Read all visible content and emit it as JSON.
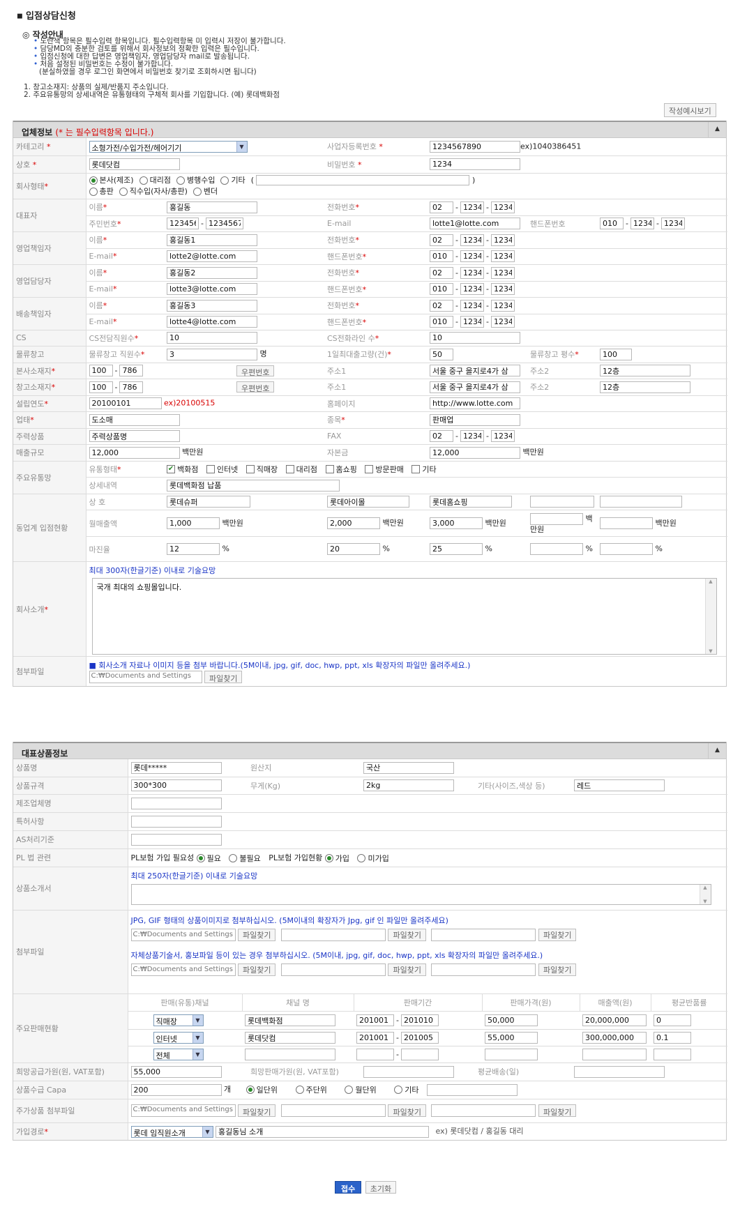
{
  "page_title": "입점상담신청",
  "guide": {
    "title": "작성안내",
    "bullets": [
      "노란색 항목은 필수입력 항목입니다. 필수입력항목 미 입력시 저장이 불가합니다.",
      "담당MD의 충분한 검토를 위해서 회사정보의 정확한 입력은 필수입니다.",
      "입점신청에 대한 답변은 영업책임자, 영업담당자 mail로 발송됩니다.",
      "처음 설정된 비밀번호는 수정이 불가합니다.",
      "(분실하였을 경우 로그인 화면에서 비밀번호 찾기로 조회하시면 됩니다)"
    ],
    "notes": [
      "1.  창고소재지: 상품의 실제/반품지 주소입니다.",
      "2.  주요유통망의 상세내역은 유통형태의 구체적 회사를 기입합니다. (예) 롯데백화점"
    ],
    "example_button": "작성예시보기"
  },
  "common": {
    "star": "*",
    "dash": "-",
    "percent": "%",
    "unit_mil": "백만원",
    "unit_people": "명",
    "unit_ea": "개",
    "zip_button": "우편번호",
    "find_button": "파일찾기",
    "file_path": "C:₩Documents and Settings",
    "paren_open": "(",
    "paren_close": ")"
  },
  "company": {
    "header": "업체정보",
    "header_note": "(* 는 필수입력항목 입니다.)",
    "category_label": "카테고리",
    "category_value": "소형가전/수입가전/헤어기기",
    "bizno_label": "사업자등록번호",
    "bizno_value": "1234567890",
    "bizno_ex": "ex)1040386451",
    "name_label": "상호",
    "name_value": "롯데닷컴",
    "pw_label": "비밀번호",
    "pw_value": "1234",
    "type_label": "회사형태",
    "types": [
      "본사(제조)",
      "대리점",
      "병행수입",
      "기타",
      "총판",
      "직수입(자사/총판)",
      "벤더"
    ],
    "ceo_label": "대표자",
    "role_labels": {
      "name": "이름",
      "jumin": "주민번호",
      "phone": "전화번호",
      "email": "E-mail",
      "mobile": "핸드폰번호"
    },
    "ceo": {
      "name": "홍길동",
      "jumin1": "123456",
      "jumin2": "1234567",
      "phone": [
        "02",
        "1234",
        "1234"
      ],
      "email": "lotte1@lotte.com",
      "mobile": [
        "010",
        "1234",
        "1234"
      ]
    },
    "sales_mgr_label": "영업책임자",
    "sales_mgr": {
      "name": "홍길동1",
      "email": "lotte2@lotte.com",
      "phone": [
        "02",
        "1234",
        "1234"
      ],
      "mobile": [
        "010",
        "1234",
        "1234"
      ]
    },
    "sales_staff_label": "영업담당자",
    "sales_staff": {
      "name": "홍길동2",
      "email": "lotte3@lotte.com",
      "phone": [
        "02",
        "1234",
        "1234"
      ],
      "mobile": [
        "010",
        "1234",
        "1234"
      ]
    },
    "ship_mgr_label": "배송책임자",
    "ship_mgr": {
      "name": "홍길동3",
      "email": "lotte4@lotte.com",
      "phone": [
        "02",
        "1234",
        "1234"
      ],
      "mobile": [
        "010",
        "1234",
        "1234"
      ]
    },
    "cs_label": "CS",
    "cs_staff_label": "CS전담직원수",
    "cs_staff": "10",
    "cs_line_label": "CS전화라인 수",
    "cs_line": "10",
    "wh_label": "물류창고",
    "wh_staff_label": "물류창고 직원수",
    "wh_staff": "3",
    "daily_label": "1일최대출고량(건)",
    "daily": "50",
    "area_label": "물류창고 평수",
    "area": "100",
    "hq_label": "본사소재지",
    "hq_zip": [
      "100",
      "786"
    ],
    "addr1_label": "주소1",
    "hq_addr1": "서울 중구 을지로4가 삼",
    "addr2_label": "주소2",
    "hq_addr2": "12층",
    "store_label": "창고소재지",
    "store_zip": [
      "100",
      "786"
    ],
    "store_addr1": "서울 중구 을지로4가 삼",
    "store_addr2": "12층",
    "founded_label": "설립연도",
    "founded": "20100101",
    "founded_ex": "ex)20100515",
    "homepage_label": "홈페이지",
    "homepage": "http://www.lotte.com",
    "biztype_label": "업태",
    "biztype": "도소매",
    "item_label": "종목",
    "item": "판매업",
    "main_prod_label": "주력상품",
    "main_prod": "주력상품명",
    "fax_label": "FAX",
    "fax": [
      "02",
      "1234",
      "1234"
    ],
    "sales_label": "매출규모",
    "sales": "12,000",
    "capital_label": "자본금",
    "capital": "12,000",
    "dist_label": "주요유통망",
    "dist_type_label": "유통형태",
    "dist_types": [
      "백화점",
      "인터넷",
      "직매장",
      "대리점",
      "홈쇼핑",
      "방문판매",
      "기타"
    ],
    "dist_detail_label": "상세내역",
    "dist_detail": "롯데백화점 납품",
    "peer_label": "동업계 입점현황",
    "peer_name_label": "상 호",
    "peer_sales_label": "월매출액",
    "peer_margin_label": "마진율",
    "peers": [
      {
        "name": "롯데슈퍼",
        "sales": "1,000",
        "margin": "12"
      },
      {
        "name": "롯데아이몰",
        "sales": "2,000",
        "margin": "20"
      },
      {
        "name": "롯데홈쇼핑",
        "sales": "3,000",
        "margin": "25"
      },
      {
        "name": "",
        "sales": "",
        "margin": ""
      },
      {
        "name": "",
        "sales": "",
        "margin": ""
      }
    ],
    "intro_label": "회사소개",
    "intro_hint": "최대 300자(한글기준) 이내로 기술요망",
    "intro_text": "국개 최대의 쇼핑몰입니다.",
    "attach_label": "첨부파일",
    "attach_hint": "■ 회사소개 자료나 이미지 등을 첨부 바랍니다.(5M이내, jpg, gif, doc, hwp, ppt, xls 확장자의 파일만 올려주세요.)"
  },
  "product": {
    "header": "대표상품정보",
    "name_label": "상품명",
    "name": "롯데*****",
    "origin_label": "원산지",
    "origin": "국산",
    "spec_label": "상품규격",
    "spec": "300*300",
    "weight_label": "무게(Kg)",
    "weight": "2kg",
    "etc_label": "기타(사이즈,색상 등)",
    "etc": "레드",
    "maker_label": "제조업체명",
    "patent_label": "특허사항",
    "as_label": "AS처리기준",
    "pl_label": "PL 법 관련",
    "pl_need_label": "PL보험 가입 필요성",
    "pl_need": [
      "필요",
      "불필요"
    ],
    "pl_join_label": "PL보험 가입현황",
    "pl_join": [
      "가입",
      "미가입"
    ],
    "intro_label": "상품소개서",
    "intro_hint": "최대 250자(한글기준) 이내로 기술요망",
    "attach_label": "첨부파일",
    "attach_hint1": "JPG, GIF 형태의 상품이미지로 첨부하십시오. (5M이내의 확장자가 Jpg, gif 인 파일만 올려주세요)",
    "attach_hint2": "자체상품기술서, 홍보파일 등이 있는 경우 첨부하십시오. (5M이내, jpg, gif, doc, hwp, ppt, xls 확장자의 파일만 올려주세요.)",
    "sales_label": "주요판매현황",
    "sales_cols": [
      "판매(유통)채널",
      "채널 명",
      "판매기간",
      "판매가격(원)",
      "매출액(원)",
      "평균반품률"
    ],
    "sales_rows": [
      {
        "channel": "직매장",
        "name": "롯데백화점",
        "from": "201001",
        "to": "201010",
        "price": "50,000",
        "amount": "20,000,000",
        "ret": "0"
      },
      {
        "channel": "인터넷",
        "name": "롯데닷컴",
        "from": "201001",
        "to": "201005",
        "price": "55,000",
        "amount": "300,000,000",
        "ret": "0.1"
      },
      {
        "channel": "전체",
        "name": "",
        "from": "",
        "to": "",
        "price": "",
        "amount": "",
        "ret": ""
      }
    ],
    "supply_label": "희망공급가원(원, VAT포함)",
    "supply": "55,000",
    "retail_label": "희망판매가원(원, VAT포함)",
    "ship_label": "평균배송(일)",
    "capa_label": "상품수급 Capa",
    "capa": "200",
    "capa_units": [
      "일단위",
      "주단위",
      "월단위",
      "기타"
    ],
    "extra_label": "주가상품 첨부파일",
    "route_label": "가입경로",
    "route_sel": "롯데 임직원소개",
    "route_text": "홍길동님 소개",
    "route_ex": "ex) 롯데닷컴 / 홍길동 대리"
  },
  "buttons": {
    "submit": "접수",
    "reset": "초기화"
  }
}
